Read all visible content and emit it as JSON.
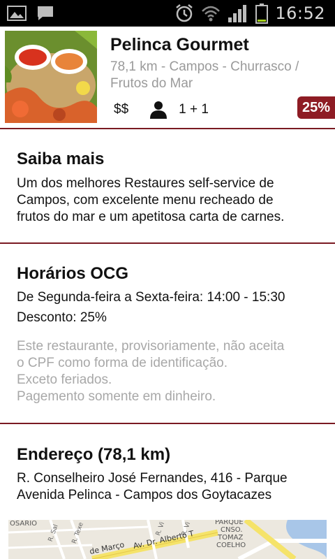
{
  "statusbar": {
    "time": "16:52",
    "icons": [
      "gallery-icon",
      "message-icon",
      "alarm-icon",
      "wifi-icon",
      "signal-icon",
      "battery-icon"
    ]
  },
  "restaurant": {
    "name": "Pelinca Gourmet",
    "subtitle_line1": "78,1 km - Campos - Churrasco /",
    "subtitle_line2": "Frutos do Mar",
    "price": "$$",
    "people": "1 + 1",
    "discount_badge": "25%"
  },
  "about": {
    "title": "Saiba mais",
    "line1": "Um dos melhores Restaures self-service de",
    "line2": "Campos, com excelente menu recheado de",
    "line3": "frutos do mar e um apetitosa carta de carnes."
  },
  "hours": {
    "title": "Horários OCG",
    "schedule": "De Segunda-feira a Sexta-feira: 14:00 - 15:30",
    "discount": "Desconto: 25%",
    "note1": "Este restaurante, provisoriamente, não aceita",
    "note2": "o CPF como forma de identificação.",
    "note3": "Exceto feriados.",
    "note4": "Pagemento somente em dinheiro."
  },
  "address": {
    "title": "Endereço (78,1 km)",
    "line1": "R. Conselheiro José Fernandes, 416 - Parque",
    "line2": "Avenida Pelinca - Campos dos Goytacazes"
  },
  "map": {
    "label_left": "OSARIO",
    "label_street1": "de Março",
    "label_street2": "Av. Dr. Alberto T",
    "label_area1": "PARQUE",
    "label_area2": "CNSO.",
    "label_area3": "TOMAZ",
    "label_area4": "COELHO",
    "label_road1": "R. Sal",
    "label_road2": "R. Texe",
    "label_road3": "R. Vi",
    "label_road4": "R. Vi"
  },
  "colors": {
    "accent": "#8e1c24",
    "divider": "#7a1a22",
    "muted": "#a8a8a8"
  }
}
